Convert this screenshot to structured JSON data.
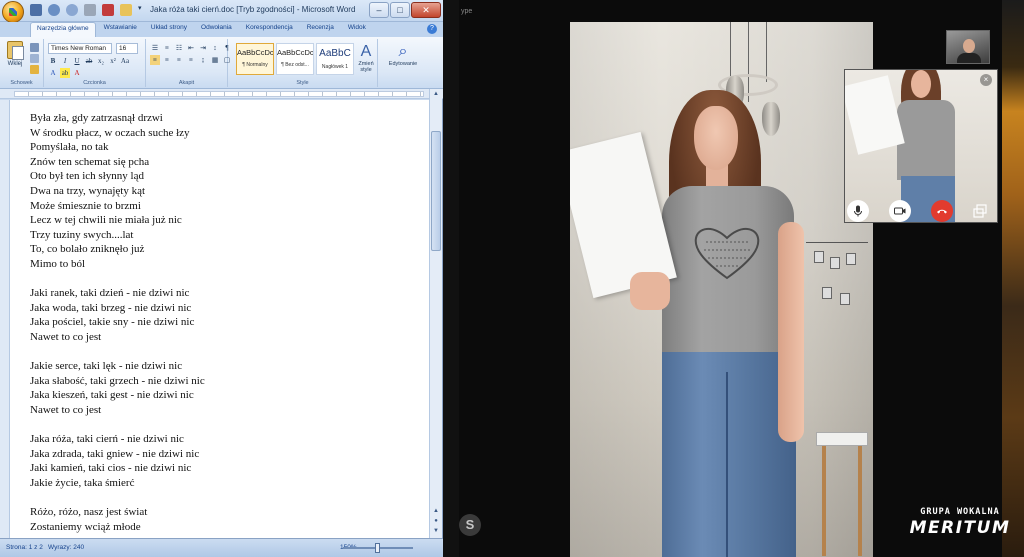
{
  "word": {
    "title": "Jaka róża taki cierń.doc [Tryb zgodności] - Microsoft Word",
    "tabs": [
      "Narzędzia główne",
      "Wstawianie",
      "Układ strony",
      "Odwołania",
      "Korespondencja",
      "Recenzja",
      "Widok"
    ],
    "active_tab": "Narzędzia główne",
    "ribbon": {
      "paste_label": "Wklej",
      "font_name": "Times New Roman",
      "font_size": "16",
      "groups": {
        "clipboard": "Schowek",
        "font": "Czcionka",
        "paragraph": "Akapit",
        "styles": "Style",
        "editing": "Edytowanie"
      },
      "styles": [
        {
          "sample": "AaBbCcDc",
          "name": "¶ Normalny"
        },
        {
          "sample": "AaBbCcDc",
          "name": "¶ Bez odst..."
        },
        {
          "sample": "AaBbC",
          "name": "Nagłówek 1"
        }
      ],
      "change_styles": "Zmień style",
      "editing": "Edytowanie"
    },
    "lyrics": [
      "Była zła, gdy zatrzasnął drzwi",
      "W środku płacz, w oczach suche łzy",
      "Pomyślała, no tak",
      "Znów ten schemat się pcha",
      "Oto był ten ich słynny ląd",
      "Dwa na trzy, wynajęty kąt",
      "Może śmiesznie to brzmi",
      "Lecz w tej chwili nie miała już nic",
      "Trzy tuziny swych....lat",
      "To, co bolało zniknęło już",
      "Mimo to ból",
      "",
      "Jaki ranek, taki dzień - nie dziwi nic",
      "Jaka woda, taki brzeg - nie dziwi nic",
      "Jaka pościel, takie sny - nie dziwi nic",
      "Nawet to co jest",
      "",
      "Jakie serce, taki lęk - nie dziwi nic",
      "Jaka słabość, taki grzech - nie dziwi nic",
      "Jaka kieszeń, taki gest - nie dziwi nic",
      "Nawet to co jest",
      "",
      "Jaka róża, taki cierń - nie dziwi nic",
      "Jaka zdrada, taki gniew - nie dziwi nic",
      "Jaki kamień, taki cios - nie dziwi nic",
      "Jakie życie, taka śmierć",
      "",
      "Różo, różo, nasz jest świat",
      "Zostaniemy wciąż młode"
    ],
    "status": {
      "page": "Strona: 1 z 2",
      "words": "Wyrazy: 240",
      "zoom": "150%"
    }
  },
  "call": {
    "window_text": "ype",
    "s_badge": "S",
    "self_close": "×"
  },
  "watermark": {
    "top": "GRUPA WOKALNA",
    "main": "MERITUM"
  },
  "colors": {
    "end_call": "#e23b2e",
    "ribbon_bg": "#dbe7f6",
    "title_text": "#1e395b"
  }
}
